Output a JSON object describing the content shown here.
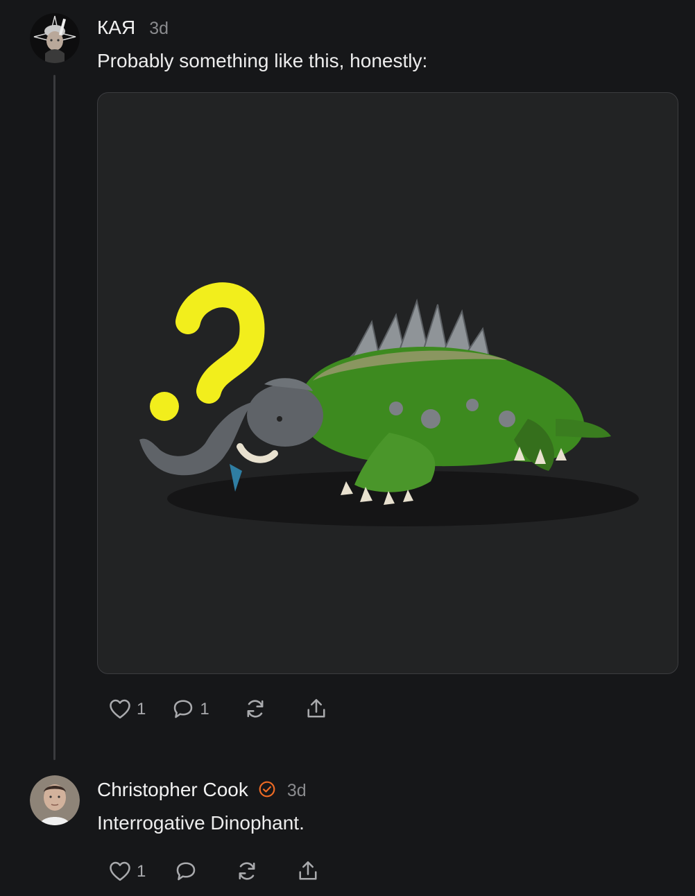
{
  "comments": [
    {
      "author": "КАЯ",
      "time": "3d",
      "text": "Probably something like this, honestly:",
      "actions": {
        "likes": "1",
        "replies": "1"
      }
    },
    {
      "author": "Christopher Cook",
      "time": "3d",
      "text": "Interrogative Dinophant.",
      "actions": {
        "likes": "1"
      }
    }
  ],
  "icons": {
    "like": "heart-icon",
    "reply": "comment-bubble-icon",
    "restack": "restack-icon",
    "share": "share-icon",
    "verified": "verified-check-icon"
  },
  "colors": {
    "background": "#161719",
    "verified_badge": "#ef6b24",
    "question_mark": "#f2ee1c",
    "creature_green": "#3d8a1f",
    "creature_gray": "#5f6368"
  }
}
